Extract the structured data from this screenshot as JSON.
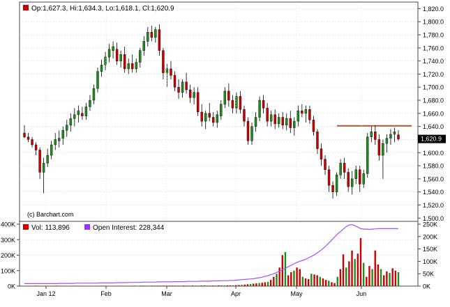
{
  "watermark": "(c) Barchart.com",
  "price_legend": {
    "text": "Op:1,627.3, Hi:1,634.3, Lo:1,618.1, Cl:1,620.9",
    "color": "#cc0000"
  },
  "volume_legend": {
    "vol_text": "Vol: 113,896",
    "vol_color": "#cc0000",
    "oi_text": "Open Interest: 228,344",
    "oi_color": "#9933ff"
  },
  "last_price_label": "1,620.9",
  "colors": {
    "up": "#1e8c1e",
    "down": "#cc0000",
    "resistance": "#b5553a",
    "oi_line": "#a64dff"
  },
  "chart_data": [
    {
      "type": "candlestick",
      "title": "",
      "x_ticks": [
        "Jan 12",
        "Feb",
        "Mar",
        "Apr",
        "May",
        "Jun"
      ],
      "y_ticks": [
        "1,500.0",
        "1,520.0",
        "1,540.0",
        "1,560.0",
        "1,580.0",
        "1,600.0",
        "1,620.0",
        "1,640.0",
        "1,660.0",
        "1,680.0",
        "1,700.0",
        "1,720.0",
        "1,740.0",
        "1,760.0",
        "1,780.0",
        "1,800.0",
        "1,820.0"
      ],
      "ylim": [
        1495,
        1830
      ],
      "last": {
        "open": 1627.3,
        "high": 1634.3,
        "low": 1618.1,
        "close": 1620.9
      },
      "resistance_level": 1641,
      "ohlc": [
        [
          1630,
          1642,
          1622,
          1624
        ],
        [
          1624,
          1630,
          1616,
          1620
        ],
        [
          1620,
          1624,
          1608,
          1612
        ],
        [
          1612,
          1616,
          1596,
          1604
        ],
        [
          1604,
          1608,
          1560,
          1570
        ],
        [
          1570,
          1592,
          1538,
          1584
        ],
        [
          1584,
          1606,
          1578,
          1596
        ],
        [
          1596,
          1618,
          1590,
          1612
        ],
        [
          1612,
          1630,
          1604,
          1620
        ],
        [
          1618,
          1634,
          1608,
          1622
        ],
        [
          1622,
          1640,
          1612,
          1634
        ],
        [
          1634,
          1650,
          1624,
          1642
        ],
        [
          1642,
          1660,
          1632,
          1652
        ],
        [
          1652,
          1668,
          1640,
          1658
        ],
        [
          1658,
          1672,
          1646,
          1664
        ],
        [
          1660,
          1670,
          1650,
          1656
        ],
        [
          1656,
          1676,
          1650,
          1670
        ],
        [
          1670,
          1688,
          1664,
          1680
        ],
        [
          1680,
          1704,
          1674,
          1698
        ],
        [
          1698,
          1730,
          1692,
          1724
        ],
        [
          1724,
          1742,
          1716,
          1734
        ],
        [
          1734,
          1754,
          1726,
          1746
        ],
        [
          1746,
          1766,
          1738,
          1758
        ],
        [
          1756,
          1770,
          1744,
          1762
        ],
        [
          1758,
          1768,
          1734,
          1740
        ],
        [
          1740,
          1756,
          1730,
          1750
        ],
        [
          1750,
          1762,
          1722,
          1728
        ],
        [
          1728,
          1744,
          1720,
          1736
        ],
        [
          1736,
          1750,
          1722,
          1728
        ],
        [
          1728,
          1744,
          1722,
          1738
        ],
        [
          1738,
          1760,
          1730,
          1756
        ],
        [
          1756,
          1778,
          1748,
          1770
        ],
        [
          1770,
          1792,
          1762,
          1784
        ],
        [
          1784,
          1794,
          1770,
          1776
        ],
        [
          1776,
          1792,
          1768,
          1788
        ],
        [
          1788,
          1796,
          1748,
          1756
        ],
        [
          1756,
          1760,
          1712,
          1722
        ],
        [
          1722,
          1736,
          1700,
          1728
        ],
        [
          1728,
          1740,
          1712,
          1718
        ],
        [
          1718,
          1724,
          1694,
          1700
        ],
        [
          1700,
          1712,
          1682,
          1692
        ],
        [
          1692,
          1712,
          1684,
          1708
        ],
        [
          1708,
          1722,
          1690,
          1696
        ],
        [
          1696,
          1704,
          1676,
          1684
        ],
        [
          1684,
          1700,
          1674,
          1692
        ],
        [
          1692,
          1700,
          1656,
          1662
        ],
        [
          1662,
          1674,
          1640,
          1648
        ],
        [
          1648,
          1664,
          1636,
          1660
        ],
        [
          1660,
          1676,
          1648,
          1654
        ],
        [
          1654,
          1662,
          1640,
          1646
        ],
        [
          1646,
          1664,
          1638,
          1658
        ],
        [
          1656,
          1680,
          1650,
          1674
        ],
        [
          1674,
          1700,
          1668,
          1694
        ],
        [
          1694,
          1706,
          1670,
          1680
        ],
        [
          1680,
          1688,
          1660,
          1668
        ],
        [
          1668,
          1692,
          1660,
          1686
        ],
        [
          1686,
          1694,
          1660,
          1666
        ],
        [
          1666,
          1672,
          1640,
          1648
        ],
        [
          1648,
          1654,
          1612,
          1618
        ],
        [
          1618,
          1646,
          1612,
          1640
        ],
        [
          1640,
          1662,
          1632,
          1654
        ],
        [
          1654,
          1686,
          1648,
          1680
        ],
        [
          1680,
          1688,
          1660,
          1668
        ],
        [
          1668,
          1676,
          1640,
          1648
        ],
        [
          1648,
          1664,
          1640,
          1658
        ],
        [
          1658,
          1666,
          1636,
          1644
        ],
        [
          1644,
          1660,
          1638,
          1654
        ],
        [
          1654,
          1662,
          1636,
          1642
        ],
        [
          1642,
          1660,
          1634,
          1652
        ],
        [
          1652,
          1664,
          1630,
          1638
        ],
        [
          1638,
          1654,
          1626,
          1648
        ],
        [
          1648,
          1672,
          1640,
          1664
        ],
        [
          1664,
          1674,
          1654,
          1660
        ],
        [
          1660,
          1672,
          1646,
          1666
        ],
        [
          1666,
          1672,
          1644,
          1650
        ],
        [
          1650,
          1656,
          1626,
          1632
        ],
        [
          1632,
          1636,
          1598,
          1606
        ],
        [
          1606,
          1614,
          1580,
          1590
        ],
        [
          1590,
          1596,
          1566,
          1574
        ],
        [
          1574,
          1580,
          1540,
          1550
        ],
        [
          1550,
          1556,
          1530,
          1540
        ],
        [
          1540,
          1570,
          1534,
          1566
        ],
        [
          1566,
          1590,
          1560,
          1584
        ],
        [
          1584,
          1592,
          1560,
          1570
        ],
        [
          1570,
          1576,
          1540,
          1548
        ],
        [
          1548,
          1572,
          1536,
          1560
        ],
        [
          1560,
          1580,
          1552,
          1574
        ],
        [
          1574,
          1580,
          1540,
          1552
        ],
        [
          1552,
          1574,
          1546,
          1568
        ],
        [
          1568,
          1630,
          1562,
          1624
        ],
        [
          1624,
          1640,
          1616,
          1632
        ],
        [
          1632,
          1642,
          1612,
          1620
        ],
        [
          1620,
          1628,
          1588,
          1596
        ],
        [
          1596,
          1620,
          1560,
          1614
        ],
        [
          1614,
          1628,
          1600,
          1622
        ],
        [
          1622,
          1636,
          1612,
          1628
        ],
        [
          1628,
          1638,
          1616,
          1632
        ],
        [
          1627.3,
          1634.3,
          1618.1,
          1620.9
        ]
      ]
    },
    {
      "type": "bar+line",
      "y_ticks_left": [
        "0K",
        "100K",
        "200K",
        "300K",
        "400K"
      ],
      "y_ticks_right": [
        "0K",
        "50K",
        "100K",
        "150K",
        "200K",
        "250K"
      ],
      "volume_k": [
        2,
        2,
        2,
        2,
        3,
        2,
        2,
        2,
        2,
        2,
        2,
        3,
        2,
        2,
        2,
        2,
        2,
        2,
        3,
        2,
        2,
        2,
        2,
        2,
        2,
        2,
        2,
        3,
        2,
        2,
        2,
        2,
        2,
        3,
        2,
        2,
        2,
        2,
        3,
        2,
        3,
        3,
        3,
        2,
        3,
        3,
        3,
        3,
        4,
        3,
        3,
        4,
        3,
        3,
        3,
        4,
        3,
        3,
        4,
        3,
        3,
        4,
        4,
        4,
        3,
        4,
        4,
        5,
        4,
        4,
        5,
        5,
        5,
        6,
        7,
        8,
        10,
        12,
        14,
        16,
        18,
        20,
        22,
        25,
        28,
        40,
        60,
        80,
        120,
        200,
        220,
        70,
        90,
        100,
        120,
        110,
        60,
        50,
        45,
        80,
        75,
        70,
        60,
        50,
        40,
        35,
        25,
        20,
        60,
        110,
        205,
        120,
        160,
        230,
        175,
        210,
        310,
        150,
        60,
        130,
        110,
        230,
        140,
        110,
        70,
        95,
        85,
        115,
        100,
        90
      ],
      "open_interest_k": [
        10,
        10,
        10,
        10,
        10,
        10,
        10,
        10,
        10,
        10,
        10,
        10,
        11,
        11,
        11,
        11,
        11,
        11,
        12,
        12,
        12,
        12,
        12,
        12,
        12,
        12,
        13,
        13,
        13,
        13,
        13,
        13,
        14,
        14,
        14,
        14,
        15,
        15,
        15,
        15,
        15,
        16,
        16,
        16,
        16,
        16,
        17,
        17,
        17,
        17,
        17,
        17,
        18,
        18,
        18,
        18,
        19,
        19,
        19,
        19,
        19,
        20,
        20,
        20,
        20,
        21,
        21,
        21,
        22,
        22,
        22,
        23,
        23,
        24,
        25,
        26,
        27,
        28,
        29,
        30,
        32,
        34,
        36,
        39,
        42,
        46,
        50,
        55,
        60,
        66,
        72,
        78,
        84,
        90,
        96,
        100,
        104,
        108,
        114,
        120,
        126,
        134,
        142,
        152,
        162,
        174,
        186,
        198,
        210,
        220,
        230,
        240,
        247,
        248,
        244,
        238,
        232,
        230,
        230,
        229,
        230,
        231,
        232,
        232,
        232,
        232,
        232,
        232,
        232,
        232
      ]
    }
  ]
}
